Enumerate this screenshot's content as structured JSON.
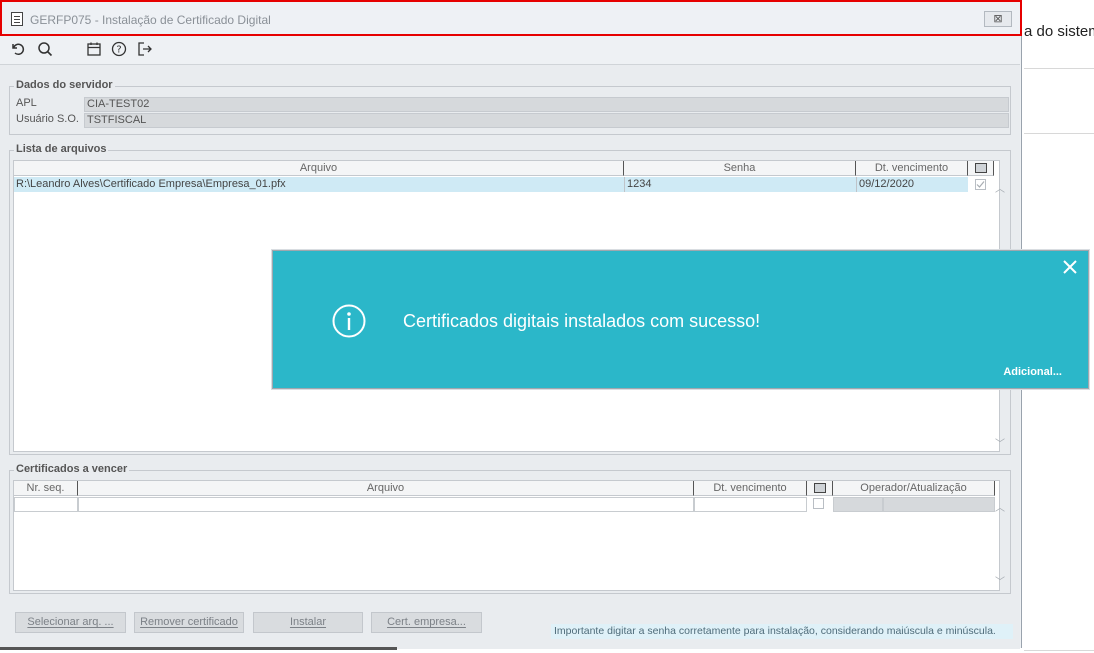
{
  "background": {
    "partial_text": "a do sistem"
  },
  "window": {
    "title": "GERFP075 - Instalação de Certificado Digital",
    "close_label": "⊠"
  },
  "toolbar": {
    "icons": [
      "refresh-icon",
      "search-icon",
      "calendar-icon",
      "help-icon",
      "exit-icon"
    ]
  },
  "server": {
    "group_title": "Dados do servidor",
    "apl_label": "APL",
    "apl_value": "CIA-TEST02",
    "user_label": "Usuário S.O.",
    "user_value": "TSTFISCAL"
  },
  "files": {
    "group_title": "Lista de arquivos",
    "columns": [
      "Arquivo",
      "Senha",
      "Dt. vencimento"
    ],
    "rows": [
      {
        "arquivo": "R:\\Leandro Alves\\Certificado Empresa\\Empresa_01.pfx",
        "senha": "1234",
        "vencimento": "09/12/2020",
        "checked": true
      }
    ]
  },
  "expiring": {
    "group_title": "Certificados a vencer",
    "columns": [
      "Nr. seq.",
      "Arquivo",
      "Dt. vencimento",
      "Operador/Atualização"
    ]
  },
  "buttons": {
    "select": "Selecionar arq. ...",
    "remove": "Remover certificado",
    "install": "Instalar",
    "cert_company": "Cert. empresa..."
  },
  "hint": "Importante digitar a senha corretamente para instalação, considerando maiúscula e minúscula.",
  "toast": {
    "message": "Certificados digitais instalados com sucesso!",
    "more_link": "Adicional...",
    "color": "#2bb7c9"
  }
}
